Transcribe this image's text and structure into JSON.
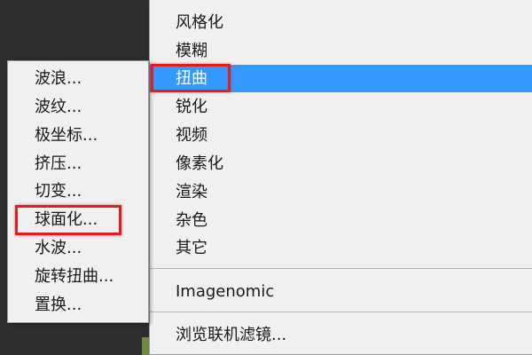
{
  "main_menu": {
    "items": [
      {
        "label": "风格化"
      },
      {
        "label": "模糊"
      },
      {
        "label": "扭曲"
      },
      {
        "label": "锐化"
      },
      {
        "label": "视频"
      },
      {
        "label": "像素化"
      },
      {
        "label": "渲染"
      },
      {
        "label": "杂色"
      },
      {
        "label": "其它"
      },
      {
        "label": "Imagenomic"
      },
      {
        "label": "浏览联机滤镜..."
      }
    ],
    "highlighted_item": "扭曲",
    "highlight_color": "#3399ff"
  },
  "submenu": {
    "items": [
      {
        "label": "波浪..."
      },
      {
        "label": "波纹..."
      },
      {
        "label": "极坐标..."
      },
      {
        "label": "挤压..."
      },
      {
        "label": "切变..."
      },
      {
        "label": "球面化..."
      },
      {
        "label": "水波..."
      },
      {
        "label": "旋转扭曲..."
      },
      {
        "label": "置换..."
      }
    ],
    "annotated_item": "球面化..."
  },
  "annotation_color": "#e01e1e"
}
